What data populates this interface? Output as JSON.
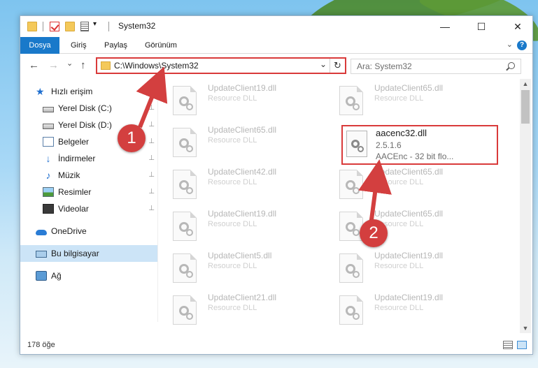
{
  "window": {
    "title": "System32",
    "minimize_glyph": "—",
    "maximize_glyph": "☐",
    "close_glyph": "✕"
  },
  "ribbon": {
    "tabs": [
      {
        "label": "Dosya",
        "active": true
      },
      {
        "label": "Giriş",
        "active": false
      },
      {
        "label": "Paylaş",
        "active": false
      },
      {
        "label": "Görünüm",
        "active": false
      }
    ],
    "help_glyph": "?",
    "chevron_glyph": "⌄"
  },
  "nav": {
    "back_glyph": "←",
    "forward_glyph": "→",
    "recent_glyph": "⌄",
    "up_glyph": "↑",
    "address": "C:\\Windows\\System32",
    "address_chevron": "⌄",
    "refresh_glyph": "↻",
    "search_placeholder": "Ara: System32"
  },
  "sidebar": {
    "items": [
      {
        "label": "Hızlı erişim",
        "icon": "star-icon",
        "pinned": false
      },
      {
        "label": "Yerel Disk (C:)",
        "icon": "disk-icon",
        "pinned": true
      },
      {
        "label": "Yerel Disk (D:)",
        "icon": "disk-icon",
        "pinned": true
      },
      {
        "label": "Belgeler",
        "icon": "documents-icon",
        "pinned": true
      },
      {
        "label": "İndirmeler",
        "icon": "downloads-icon",
        "pinned": true
      },
      {
        "label": "Müzik",
        "icon": "music-icon",
        "pinned": true
      },
      {
        "label": "Resimler",
        "icon": "pictures-icon",
        "pinned": true
      },
      {
        "label": "Videolar",
        "icon": "videos-icon",
        "pinned": true
      },
      {
        "label": "OneDrive",
        "icon": "onedrive-icon",
        "pinned": false
      },
      {
        "label": "Bu bilgisayar",
        "icon": "this-pc-icon",
        "pinned": false,
        "selected": true
      },
      {
        "label": "Ağ",
        "icon": "network-icon",
        "pinned": false
      }
    ],
    "pin_glyph": "📌"
  },
  "files": [
    {
      "name": "UpdateClient19.dll",
      "desc": "Resource DLL"
    },
    {
      "name": "UpdateClient65.dll",
      "desc": "Resource DLL"
    },
    {
      "name": "UpdateClient65.dll",
      "desc": "Resource DLL"
    },
    {
      "name": "UpdateClient42.dll",
      "desc": "Resource DLL"
    },
    {
      "name": "UpdateClient65.dll",
      "desc": "Resource DLL"
    },
    {
      "name": "UpdateClient19.dll",
      "desc": "Resource DLL"
    },
    {
      "name": "UpdateClient65.dll",
      "desc": "Resource DLL"
    },
    {
      "name": "UpdateClient5.dll",
      "desc": "Resource DLL"
    },
    {
      "name": "UpdateClient19.dll",
      "desc": "Resource DLL"
    },
    {
      "name": "UpdateClient21.dll",
      "desc": "Resource DLL"
    },
    {
      "name": "UpdateClient19.dll",
      "desc": "Resource DLL"
    }
  ],
  "highlighted_file": {
    "name": "aacenc32.dll",
    "version": "2.5.1.6",
    "description": "AACEnc - 32 bit flo..."
  },
  "status": {
    "count": "178 öğe"
  },
  "annotations": {
    "step1": "1",
    "step2": "2",
    "color": "#d33f3f"
  }
}
